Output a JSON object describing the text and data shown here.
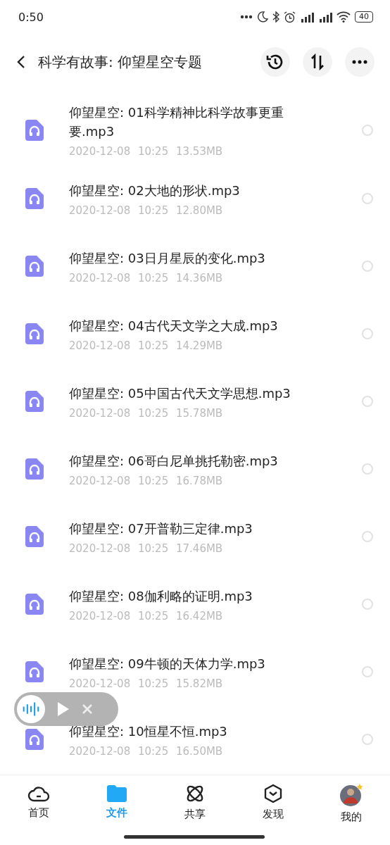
{
  "status_bar": {
    "time": "0:50",
    "battery": "40"
  },
  "header": {
    "title": "科学有故事: 仰望星空专题"
  },
  "files": [
    {
      "name": "仰望星空: 01科学精神比科学故事更重要.mp3",
      "date": "2020-12-08",
      "time": "10:25",
      "size": "13.53MB",
      "checked": false
    },
    {
      "name": "仰望星空: 02大地的形状.mp3",
      "date": "2020-12-08",
      "time": "10:25",
      "size": "12.80MB",
      "checked": false
    },
    {
      "name": "仰望星空: 03日月星辰的变化.mp3",
      "date": "2020-12-08",
      "time": "10:25",
      "size": "14.36MB",
      "checked": false
    },
    {
      "name": "仰望星空: 04古代天文学之大成.mp3",
      "date": "2020-12-08",
      "time": "10:25",
      "size": "14.29MB",
      "checked": false
    },
    {
      "name": "仰望星空: 05中国古代天文学思想.mp3",
      "date": "2020-12-08",
      "time": "10:25",
      "size": "15.78MB",
      "checked": false
    },
    {
      "name": "仰望星空: 06哥白尼单挑托勒密.mp3",
      "date": "2020-12-08",
      "time": "10:25",
      "size": "16.78MB",
      "checked": false
    },
    {
      "name": "仰望星空: 07开普勒三定律.mp3",
      "date": "2020-12-08",
      "time": "10:25",
      "size": "17.46MB",
      "checked": false
    },
    {
      "name": "仰望星空: 08伽利略的证明.mp3",
      "date": "2020-12-08",
      "time": "10:25",
      "size": "16.42MB",
      "checked": false
    },
    {
      "name": "仰望星空: 09牛顿的天体力学.mp3",
      "date": "2020-12-08",
      "time": "10:25",
      "size": "15.82MB",
      "checked": false
    },
    {
      "name": "仰望星空: 10恒星不恒.mp3",
      "date": "2020-12-08",
      "time": "10:25",
      "size": "16.50MB",
      "checked": false
    }
  ],
  "bottom_nav": [
    {
      "kind": "home",
      "label": "首页",
      "selected": false
    },
    {
      "kind": "files",
      "label": "文件",
      "selected": true
    },
    {
      "kind": "share",
      "label": "共享",
      "selected": false
    },
    {
      "kind": "discover",
      "label": "发现",
      "selected": false
    },
    {
      "kind": "me",
      "label": "我的",
      "selected": false
    }
  ]
}
